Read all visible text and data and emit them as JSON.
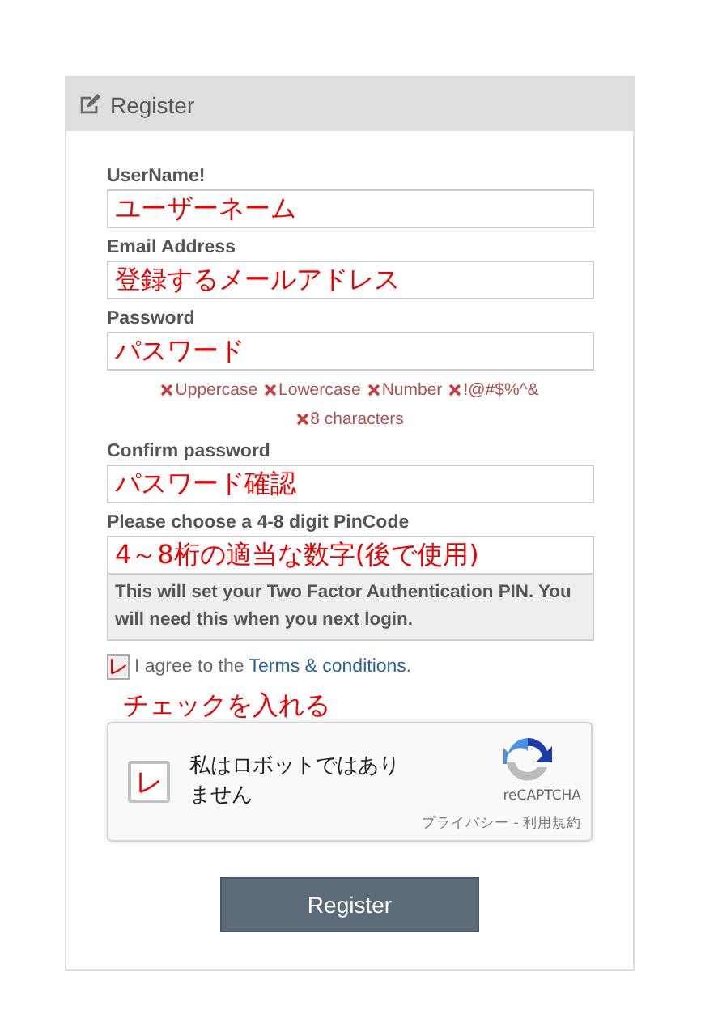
{
  "panel": {
    "title": "Register"
  },
  "fields": [
    {
      "label": "UserName!",
      "annotation": "ユーザーネーム"
    },
    {
      "label": "Email Address",
      "annotation": "登録するメールアドレス"
    },
    {
      "label": "Password",
      "annotation": "パスワード",
      "rules": [
        {
          "text": "Uppercase"
        },
        {
          "text": "Lowercase"
        },
        {
          "text": "Number"
        },
        {
          "text": "!@#$%^&"
        },
        {
          "text": "8 characters"
        }
      ]
    },
    {
      "label": "Confirm password",
      "annotation": "パスワード確認"
    },
    {
      "label": "Please choose a 4-8 digit PinCode",
      "annotation": "4～8桁の適当な数字(後で使用)",
      "info": "This will set your Two Factor Authentication PIN. You will need this when you next login."
    }
  ],
  "terms": {
    "checked": true,
    "mark_annotation": "レ",
    "prefix": "I agree to the",
    "link": "Terms & conditions",
    "suffix": "."
  },
  "captcha_annotation": "チェックを入れる",
  "captcha": {
    "checked": true,
    "mark_annotation": "レ",
    "label": "私はロボットではありません",
    "brand": "reCAPTCHA",
    "privacy": "プライバシー",
    "separator": "-",
    "terms": "利用規約"
  },
  "button": "Register"
}
